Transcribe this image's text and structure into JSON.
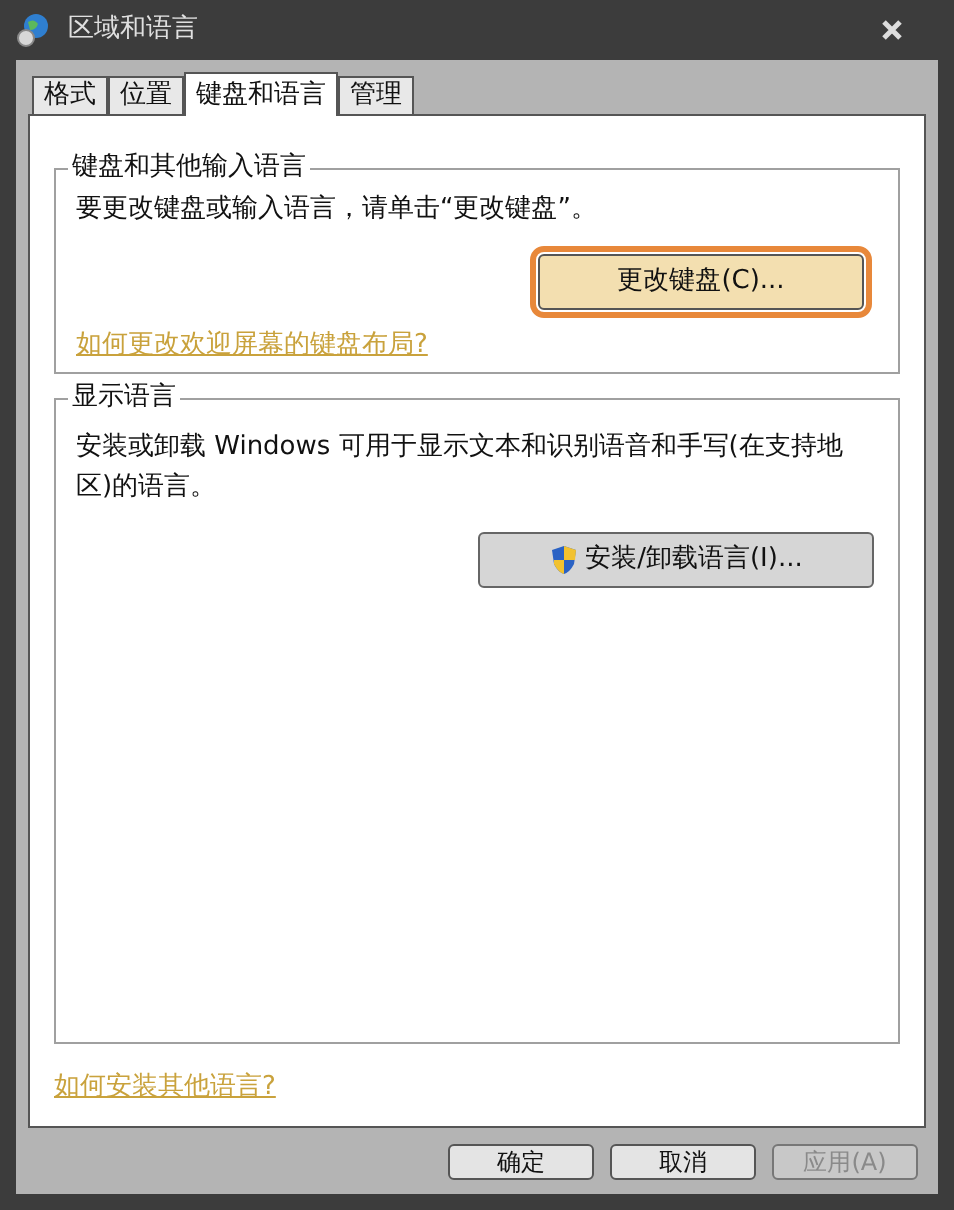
{
  "window": {
    "title": "区域和语言"
  },
  "tabs": [
    {
      "label": "格式",
      "selected": false
    },
    {
      "label": "位置",
      "selected": false
    },
    {
      "label": "键盘和语言",
      "selected": true
    },
    {
      "label": "管理",
      "selected": false
    }
  ],
  "keyboard_group": {
    "title": "键盘和其他输入语言",
    "description": "要更改键盘或输入语言，请单击“更改键盘”。",
    "button": {
      "label": "更改键盘(C)...",
      "focused": true
    },
    "link": "如何更改欢迎屏幕的键盘布局?"
  },
  "display_group": {
    "title": "显示语言",
    "description": "安装或卸载 Windows 可用于显示文本和识别语音和手写(在支持地区)的语言。",
    "button": {
      "label": "安装/卸载语言(I)...",
      "focused": false
    }
  },
  "help_link": "如何安装其他语言?",
  "buttons": [
    {
      "label": "确定",
      "disabled": false
    },
    {
      "label": "取消",
      "disabled": false
    },
    {
      "label": "应用(A)",
      "disabled": true
    }
  ]
}
